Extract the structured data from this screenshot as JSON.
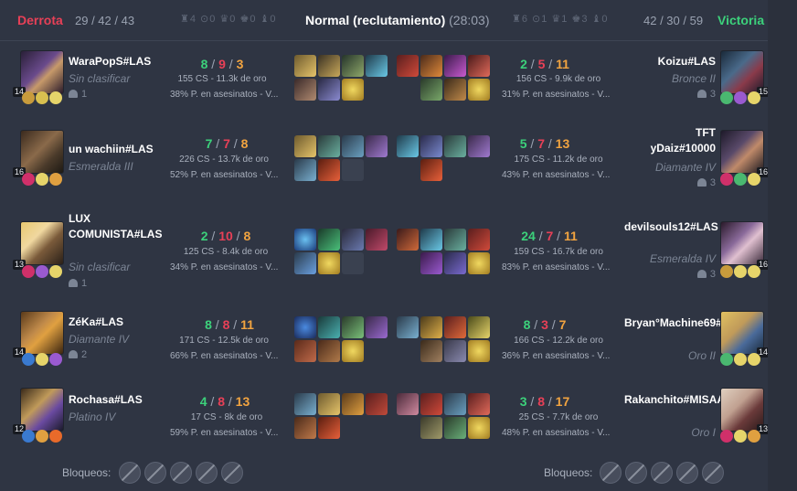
{
  "header": {
    "result_left": "Derrota",
    "kda_left": "29 / 42 / 43",
    "objectives_left": "♜4 ⊙0 ♛0 ♚0 ♝0",
    "title": "Normal (reclutamiento)",
    "duration": "(28:03)",
    "objectives_right": "♜6 ⊙1 ♛1 ♚3 ♝0",
    "kda_right": "42 / 30 / 59",
    "result_right": "Victoria"
  },
  "left_players": [
    {
      "name": "WaraPopS#LAS",
      "rank": "Sin clasificar",
      "group": "1",
      "level": "14",
      "k": "8",
      "d": "9",
      "a": "3",
      "cs": "155 CS - 11.3k de oro",
      "kp": "38% P. en asesinatos - V..."
    },
    {
      "name": "un wachiin#LAS",
      "rank": "Esmeralda III",
      "group": "",
      "level": "16",
      "k": "7",
      "d": "7",
      "a": "8",
      "cs": "226 CS - 13.7k de oro",
      "kp": "52% P. en asesinatos - V..."
    },
    {
      "name": "LUX COMUNISTA#LAS",
      "rank": "Sin clasificar",
      "group": "1",
      "level": "13",
      "k": "2",
      "d": "10",
      "a": "8",
      "cs": "125 CS - 8.4k de oro",
      "kp": "34% P. en asesinatos - V..."
    },
    {
      "name": "ZéKa#LAS",
      "rank": "Diamante IV",
      "group": "2",
      "level": "14",
      "k": "8",
      "d": "8",
      "a": "11",
      "cs": "171 CS - 12.5k de oro",
      "kp": "66% P. en asesinatos - V..."
    },
    {
      "name": "Rochasa#LAS",
      "rank": "Platino IV",
      "group": "2",
      "level": "12",
      "k": "4",
      "d": "8",
      "a": "13",
      "cs": "17 CS - 8k de oro",
      "kp": "59% P. en asesinatos - V..."
    }
  ],
  "right_players": [
    {
      "name": "Koizu#LAS",
      "rank": "Bronce II",
      "group": "3",
      "level": "15",
      "k": "2",
      "d": "5",
      "a": "11",
      "cs": "156 CS - 9.9k de oro",
      "kp": "31% P. en asesinatos - V..."
    },
    {
      "name": "TFT yDaiz#10000",
      "rank": "Diamante IV",
      "group": "3",
      "level": "16",
      "k": "5",
      "d": "7",
      "a": "13",
      "cs": "175 CS - 11.2k de oro",
      "kp": "43% P. en asesinatos - V..."
    },
    {
      "name": "devilsouls12#LAS",
      "rank": "Esmeralda IV",
      "group": "3",
      "level": "16",
      "k": "24",
      "d": "7",
      "a": "11",
      "cs": "159 CS - 16.7k de oro",
      "kp": "83% P. en asesinatos - V..."
    },
    {
      "name": "Bryan°Machine69#LAS",
      "rank": "Oro II",
      "group": "",
      "level": "14",
      "k": "8",
      "d": "3",
      "a": "7",
      "cs": "166 CS - 12.2k de oro",
      "kp": "36% P. en asesinatos - V..."
    },
    {
      "name": "Rakanchito#MISAA",
      "rank": "Oro I",
      "group": "",
      "level": "13",
      "k": "3",
      "d": "8",
      "a": "17",
      "cs": "25 CS - 7.7k de oro",
      "kp": "48% P. en asesinatos - V..."
    }
  ],
  "footer": {
    "bans_label_left": "Bloqueos:",
    "bans_label_right": "Bloqueos:"
  },
  "colors": {
    "defeat": "#e84057",
    "victory": "#3cd17b",
    "kills": "#3cd17b",
    "deaths": "#e84057",
    "assists": "#f2a440"
  }
}
